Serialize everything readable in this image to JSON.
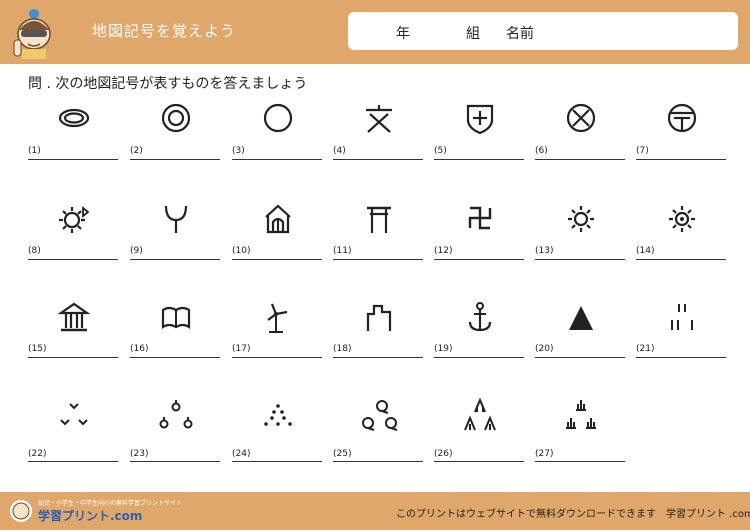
{
  "header": {
    "title": "地図記号を覚えよう",
    "name_box": {
      "year_label": "年",
      "class_label": "組",
      "name_label": "名前"
    }
  },
  "question": "問 . 次の地図記号が表すものを答えましょう",
  "items": [
    {
      "number": "(1)",
      "symbol": "castle-ruins-icon"
    },
    {
      "number": "(2)",
      "symbol": "prefecture-office-icon"
    },
    {
      "number": "(3)",
      "symbol": "city-hall-icon"
    },
    {
      "number": "(4)",
      "symbol": "school-icon"
    },
    {
      "number": "(5)",
      "symbol": "hospital-icon"
    },
    {
      "number": "(6)",
      "symbol": "police-station-icon"
    },
    {
      "number": "(7)",
      "symbol": "post-office-icon"
    },
    {
      "number": "(8)",
      "symbol": "factory-icon"
    },
    {
      "number": "(9)",
      "symbol": "fire-station-icon"
    },
    {
      "number": "(10)",
      "symbol": "nursing-home-icon"
    },
    {
      "number": "(11)",
      "symbol": "shrine-icon"
    },
    {
      "number": "(12)",
      "symbol": "temple-icon"
    },
    {
      "number": "(13)",
      "symbol": "power-plant-icon"
    },
    {
      "number": "(14)",
      "symbol": "town-office-icon"
    },
    {
      "number": "(15)",
      "symbol": "museum-icon"
    },
    {
      "number": "(16)",
      "symbol": "library-icon"
    },
    {
      "number": "(17)",
      "symbol": "wind-turbine-icon"
    },
    {
      "number": "(18)",
      "symbol": "castle-ruin-icon"
    },
    {
      "number": "(19)",
      "symbol": "harbor-icon"
    },
    {
      "number": "(20)",
      "symbol": "triangulation-point-icon"
    },
    {
      "number": "(21)",
      "symbol": "rice-field-icon"
    },
    {
      "number": "(22)",
      "symbol": "field-icon"
    },
    {
      "number": "(23)",
      "symbol": "orchard-icon"
    },
    {
      "number": "(24)",
      "symbol": "tea-field-icon"
    },
    {
      "number": "(25)",
      "symbol": "broadleaf-forest-icon"
    },
    {
      "number": "(26)",
      "symbol": "coniferous-forest-icon"
    },
    {
      "number": "(27)",
      "symbol": "wasteland-icon"
    }
  ],
  "footer": {
    "logo_tagline": "幼児・小学生・中学生向けの無料学習プリントサイト",
    "logo_text": "学習プリント.com",
    "notice": "このプリントはウェブサイトで無料ダウンロードできます　学習プリント .com"
  }
}
